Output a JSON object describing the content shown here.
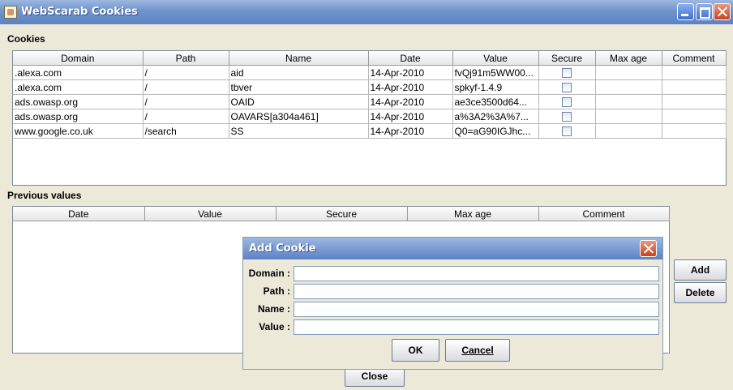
{
  "window": {
    "title": "WebScarab Cookies"
  },
  "cookies": {
    "label": "Cookies",
    "columns": [
      "Domain",
      "Path",
      "Name",
      "Date",
      "Value",
      "Secure",
      "Max age",
      "Comment"
    ],
    "rows": [
      {
        "domain": ".alexa.com",
        "path": "/",
        "name": "aid",
        "date": "14-Apr-2010",
        "value": "fvQj91m5WW00...",
        "secure": false,
        "max_age": "",
        "comment": ""
      },
      {
        "domain": ".alexa.com",
        "path": "/",
        "name": "tbver",
        "date": "14-Apr-2010",
        "value": "spkyf-1.4.9",
        "secure": false,
        "max_age": "",
        "comment": ""
      },
      {
        "domain": "ads.owasp.org",
        "path": "/",
        "name": "OAID",
        "date": "14-Apr-2010",
        "value": "ae3ce3500d64...",
        "secure": false,
        "max_age": "",
        "comment": ""
      },
      {
        "domain": "ads.owasp.org",
        "path": "/",
        "name": "OAVARS[a304a461]",
        "date": "14-Apr-2010",
        "value": "a%3A2%3A%7...",
        "secure": false,
        "max_age": "",
        "comment": ""
      },
      {
        "domain": "www.google.co.uk",
        "path": "/search",
        "name": "SS",
        "date": "14-Apr-2010",
        "value": "Q0=aG90IGJhc...",
        "secure": false,
        "max_age": "",
        "comment": ""
      }
    ]
  },
  "previous": {
    "label": "Previous values",
    "columns": [
      "Date",
      "Value",
      "Secure",
      "Max age",
      "Comment"
    ]
  },
  "buttons": {
    "add": "Add",
    "delete": "Delete",
    "close": "Close"
  },
  "dialog": {
    "title": "Add Cookie",
    "fields": [
      {
        "label": "Domain :",
        "value": ""
      },
      {
        "label": "Path :",
        "value": ""
      },
      {
        "label": "Name :",
        "value": ""
      },
      {
        "label": "Value :",
        "value": ""
      }
    ],
    "ok": "OK",
    "cancel": "Cancel"
  }
}
